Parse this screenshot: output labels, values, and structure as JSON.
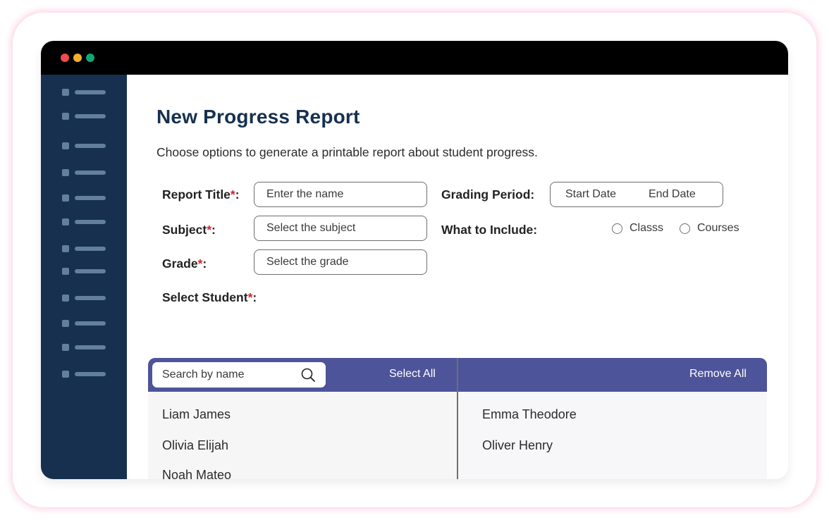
{
  "window": {
    "controls": [
      {
        "name": "close",
        "color": "#ed4c4c"
      },
      {
        "name": "minimize",
        "color": "#f6ae2d"
      },
      {
        "name": "maximize",
        "color": "#11a676"
      }
    ]
  },
  "sidebar": {
    "item_count": 12
  },
  "page": {
    "title": "New Progress Report",
    "subtitle": "Choose options to generate a printable report about student progress."
  },
  "form": {
    "report_title": {
      "label": "Report Title",
      "required_mark": "*",
      "colon": ":",
      "placeholder": "Enter the name"
    },
    "subject": {
      "label": "Subject",
      "required_mark": "*",
      "colon": ":",
      "placeholder": "Select the subject"
    },
    "grade": {
      "label": "Grade",
      "required_mark": "*",
      "colon": ":",
      "placeholder": "Select the grade"
    },
    "grading_period": {
      "label": "Grading Period:",
      "start_placeholder": "Start Date",
      "end_placeholder": "End Date"
    },
    "what_to_include": {
      "label": "What to Include:",
      "options": [
        {
          "label": "Classs",
          "checked": false
        },
        {
          "label": "Courses",
          "checked": false
        }
      ]
    },
    "select_student": {
      "label": "Select Student",
      "required_mark": "*",
      "colon": ":"
    }
  },
  "student_picker": {
    "search_placeholder": "Search by name",
    "select_all_label": "Select All",
    "remove_all_label": "Remove All",
    "available": [
      "Liam James",
      "Olivia Elijah",
      "Noah Mateo"
    ],
    "selected": [
      "Emma Theodore",
      "Oliver Henry"
    ]
  },
  "colors": {
    "sidebar": "#17304f",
    "title": "#17304f",
    "accent": "#4e5499",
    "required": "#d9232a"
  }
}
